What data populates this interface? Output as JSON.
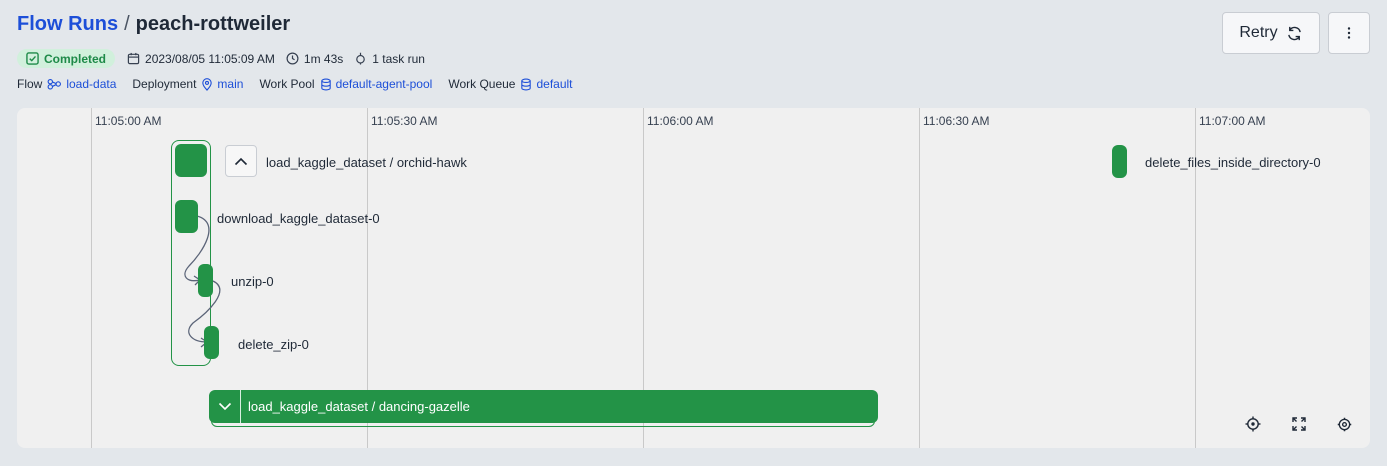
{
  "breadcrumb": {
    "root": "Flow Runs",
    "separator": "/",
    "current": "peach-rottweiler"
  },
  "meta": {
    "state": "Completed",
    "start_time": "2023/08/05 11:05:09 AM",
    "duration": "1m 43s",
    "task_runs": "1 task run"
  },
  "properties": {
    "flow": {
      "key": "Flow",
      "value": "load-data"
    },
    "deployment": {
      "key": "Deployment",
      "value": "main"
    },
    "work_pool": {
      "key": "Work Pool",
      "value": "default-agent-pool"
    },
    "work_queue": {
      "key": "Work Queue",
      "value": "default"
    }
  },
  "actions": {
    "retry_label": "Retry"
  },
  "timeline": {
    "ticks": [
      "11:05:00 AM",
      "11:05:30 AM",
      "11:06:00 AM",
      "11:06:30 AM",
      "11:07:00 AM"
    ],
    "subflow_expanded": "load_kaggle_dataset / orchid-hawk",
    "tasks": [
      "download_kaggle_dataset-0",
      "unzip-0",
      "delete_zip-0"
    ],
    "standalone_task": "delete_files_inside_directory-0",
    "subflow_collapsed": "load_kaggle_dataset / dancing-gazelle"
  },
  "colors": {
    "completed": "#239347",
    "link": "#1d4fd8",
    "badge_bg": "#d1f0dc"
  },
  "icons": {
    "state": "check-square-icon",
    "calendar": "calendar-icon",
    "clock": "clock-icon",
    "task": "task-run-icon",
    "flow": "flow-icon",
    "deployment": "location-pin-icon",
    "pool": "database-icon",
    "queue": "database-icon",
    "retry": "refresh-icon",
    "menu": "kebab-menu-icon"
  }
}
